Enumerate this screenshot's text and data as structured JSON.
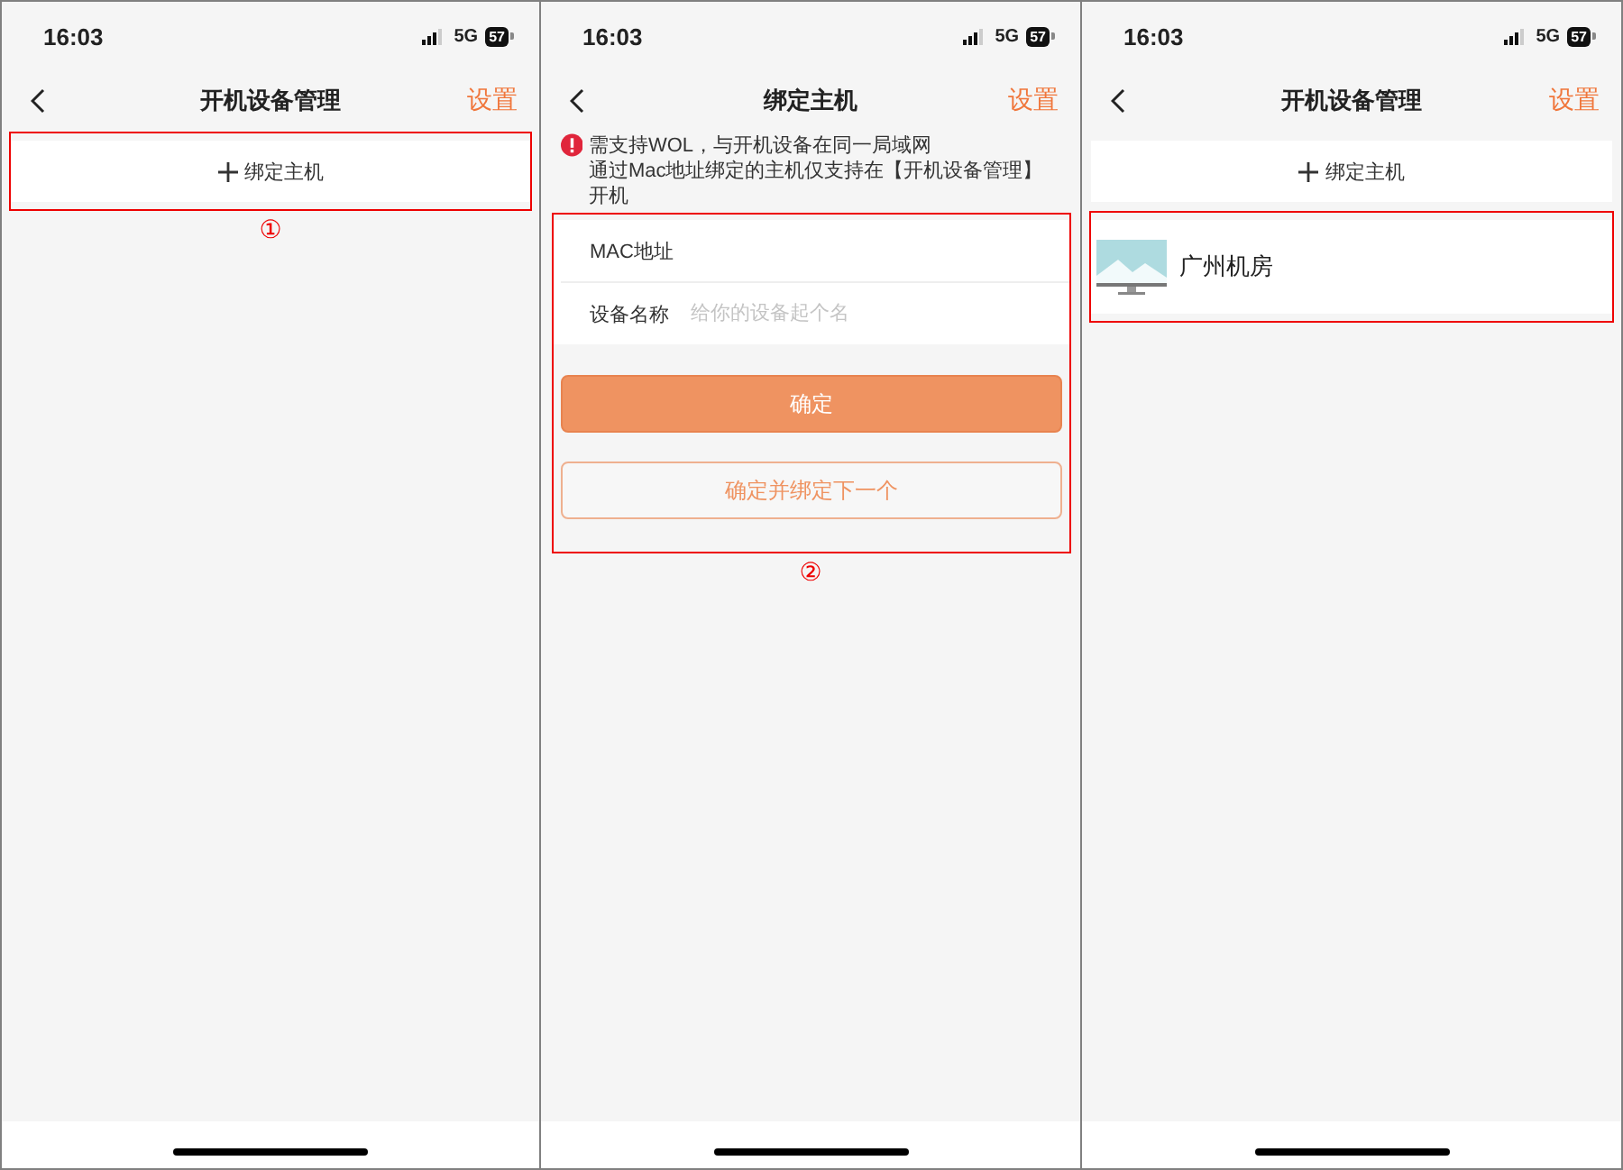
{
  "screens": [
    {
      "kind": "list",
      "status": {
        "time": "16:03",
        "network": "5G",
        "battery": "57"
      },
      "title": "开机设备管理",
      "action": "设置",
      "add_button": {
        "label": "绑定主机",
        "highlighted": true,
        "callout": "①"
      }
    },
    {
      "kind": "form",
      "status": {
        "time": "16:03",
        "network": "5G",
        "battery": "57"
      },
      "title": "绑定主机",
      "action": "设置",
      "notice": [
        "需支持WOL，与开机设备在同一局域网",
        "通过Mac地址绑定的主机仅支持在【开机设备管理】开机"
      ],
      "form": {
        "highlighted": true,
        "callout": "②",
        "fields": [
          {
            "label": "MAC地址"
          },
          {
            "label": "设备名称",
            "placeholder": "给你的设备起个名"
          }
        ],
        "primary_button": "确定",
        "secondary_button": "确定并绑定下一个"
      }
    },
    {
      "kind": "list",
      "status": {
        "time": "16:03",
        "network": "5G",
        "battery": "57"
      },
      "title": "开机设备管理",
      "action": "设置",
      "add_button": {
        "label": "绑定主机",
        "highlighted": false
      },
      "devices": [
        {
          "name": "广州机房",
          "highlighted": true
        }
      ]
    }
  ]
}
